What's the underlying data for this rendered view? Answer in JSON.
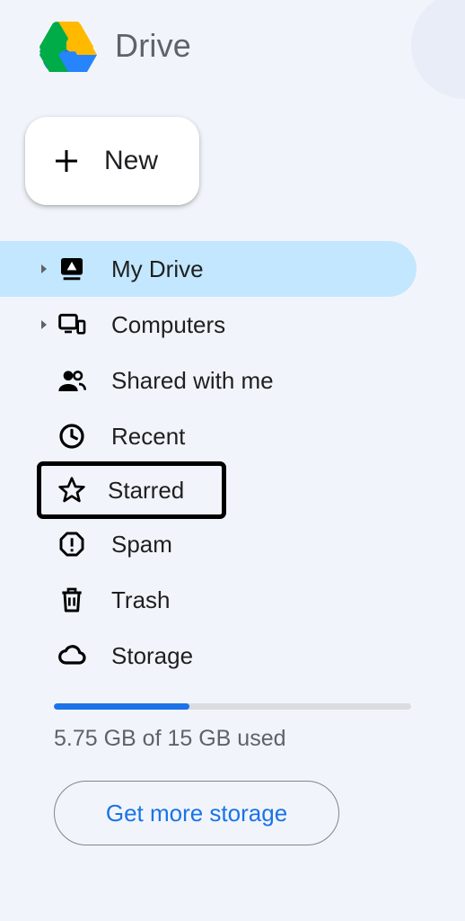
{
  "app_title": "Drive",
  "new_button_label": "New",
  "nav": {
    "my_drive": "My Drive",
    "computers": "Computers",
    "shared": "Shared with me",
    "recent": "Recent",
    "starred": "Starred",
    "spam": "Spam",
    "trash": "Trash",
    "storage": "Storage"
  },
  "storage": {
    "used_text": "5.75 GB of 15 GB used",
    "percent_fill": 38,
    "get_more_label": "Get more storage"
  },
  "colors": {
    "accent": "#1a73e8",
    "selected_bg": "#c2e7ff"
  }
}
